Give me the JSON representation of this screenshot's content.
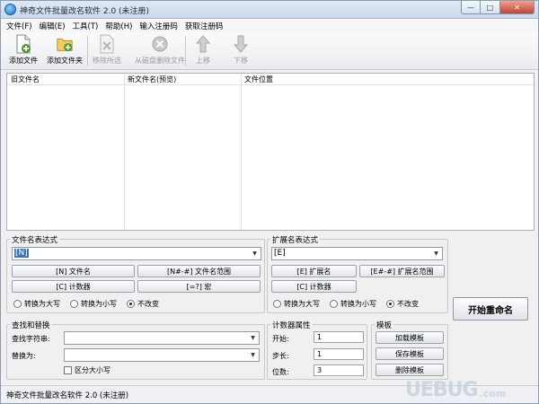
{
  "window": {
    "title": "神奇文件批量改名软件 2.0 (未注册)",
    "controls": {
      "minimize": "—",
      "maximize": "□",
      "close": "✕"
    }
  },
  "menu": [
    "文件(F)",
    "编辑(E)",
    "工具(T)",
    "帮助(H)",
    "输入注册码",
    "获取注册码"
  ],
  "toolbar": {
    "add_file": "添加文件",
    "add_folder": "添加文件夹",
    "remove_selected": "移除所选",
    "delete_from_disk": "从磁盘删除文件",
    "move_up": "上移",
    "move_down": "下移"
  },
  "file_list": {
    "columns": [
      "旧文件名",
      "新文件名(预览)",
      "文件位置"
    ],
    "rows": []
  },
  "filename_expr": {
    "title": "文件名表达式",
    "value": "[N]",
    "buttons": [
      "[N] 文件名",
      "[N#-#] 文件名范围",
      "[C] 计数器",
      "[=?] 宏"
    ],
    "case_options": [
      "转换为大写",
      "转换为小写",
      "不改变"
    ],
    "case_selected": 2
  },
  "ext_expr": {
    "title": "扩展名表达式",
    "value": "[E]",
    "buttons": [
      "[E] 扩展名",
      "[E#-#] 扩展名范围",
      "[C] 计数器"
    ],
    "case_options": [
      "转换为大写",
      "转换为小写",
      "不改变"
    ],
    "case_selected": 2
  },
  "find_replace": {
    "title": "查找和替换",
    "find_label": "查找字符串:",
    "find_value": "",
    "replace_label": "替换为:",
    "replace_value": "",
    "case_sensitive_label": "区分大小写",
    "case_sensitive_checked": false
  },
  "counter": {
    "title": "计数器属性",
    "start_label": "开始:",
    "start_value": "1",
    "step_label": "步长:",
    "step_value": "1",
    "digits_label": "位数:",
    "digits_value": "3"
  },
  "templates": {
    "title": "模板",
    "load": "加载模板",
    "save": "保存模板",
    "delete": "删除模板"
  },
  "start_button": "开始重命名",
  "status": "神奇文件批量改名软件 2.0 (未注册)",
  "watermark": {
    "text": "UEBUG",
    "suffix": ".com"
  },
  "colors": {
    "accent": "#3b73c4",
    "add_icon": "#4a9a2b",
    "disabled_icon": "#b5b5b5"
  }
}
